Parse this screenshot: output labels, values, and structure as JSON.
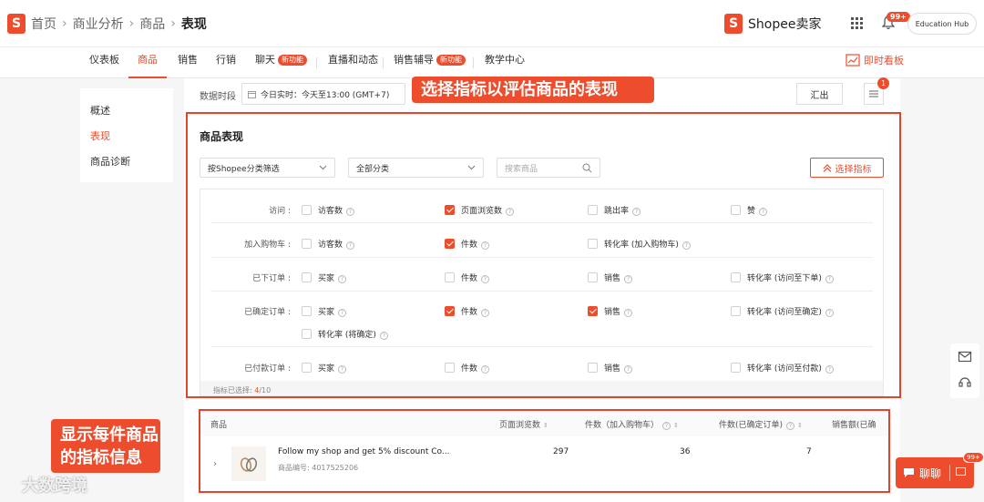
{
  "breadcrumb": {
    "home": "首页",
    "l1": "商业分析",
    "l2": "商品",
    "current": "表现"
  },
  "header": {
    "brand": "Shopee卖家",
    "notif_badge": "99+",
    "edu_hub": "Education Hub"
  },
  "nav": {
    "items": [
      "仪表板",
      "商品",
      "销售",
      "行销",
      "聊天",
      "直播和动态",
      "销售辅导",
      "教学中心"
    ],
    "new_tag": "新功能",
    "live_board": "即时看板"
  },
  "sidebar": {
    "items": [
      "概述",
      "表现",
      "商品诊断"
    ]
  },
  "toolbar": {
    "period_label": "数据时段",
    "period_value": "今日实时：今天至13:00 (GMT+7)",
    "export": "汇出",
    "menu_badge": "1"
  },
  "callouts": {
    "top": "选择指标以评估商品的表现",
    "bottom_line1": "显示每件商品",
    "bottom_line2": "的指标信息"
  },
  "section": {
    "title": "商品表现",
    "filter_category": "按Shopee分类筛选",
    "filter_all": "全部分类",
    "search_placeholder": "搜索商品",
    "pick_metrics": "选择指标"
  },
  "metrics": {
    "rows": [
      {
        "label": "访问 :",
        "options": [
          {
            "text": "访客数",
            "checked": false
          },
          {
            "text": "页面浏览数",
            "checked": true
          },
          {
            "text": "跳出率",
            "checked": false
          },
          {
            "text": "赞",
            "checked": false
          }
        ]
      },
      {
        "label": "加入购物车 :",
        "options": [
          {
            "text": "访客数",
            "checked": false
          },
          {
            "text": "件数",
            "checked": true
          },
          {
            "text": "转化率 (加入购物车)",
            "checked": false
          }
        ]
      },
      {
        "label": "已下订单 :",
        "options": [
          {
            "text": "买家",
            "checked": false
          },
          {
            "text": "件数",
            "checked": false
          },
          {
            "text": "销售",
            "checked": false
          },
          {
            "text": "转化率 (访问至下单)",
            "checked": false
          }
        ]
      },
      {
        "label": "已确定订单 :",
        "options": [
          {
            "text": "买家",
            "checked": false
          },
          {
            "text": "件数",
            "checked": true
          },
          {
            "text": "销售",
            "checked": true
          },
          {
            "text": "转化率 (访问至确定)",
            "checked": false
          },
          {
            "text": "转化率 (将确定)",
            "checked": false
          }
        ]
      },
      {
        "label": "已付款订单 :",
        "options": [
          {
            "text": "买家",
            "checked": false
          },
          {
            "text": "件数",
            "checked": false
          },
          {
            "text": "销售",
            "checked": false
          },
          {
            "text": "转化率 (访问至付款)",
            "checked": false
          }
        ]
      }
    ],
    "selected_label": "指标已选择:",
    "selected_count": "4",
    "selected_total": "/10"
  },
  "table": {
    "headers": [
      "商品",
      "页面浏览数",
      "件数（加入购物车）",
      "件数(已确定订单)",
      "销售额(已确"
    ],
    "rows": [
      {
        "name": "Follow my shop and get 5% discount Co...",
        "id": "商品编号: 4017525206",
        "values": [
          "297",
          "36",
          "7"
        ]
      }
    ]
  },
  "float": {
    "chat": "聊聊",
    "chat_badge": "99+"
  },
  "watermark": "大数跨境",
  "colors": {
    "accent": "#ee4d2d"
  }
}
